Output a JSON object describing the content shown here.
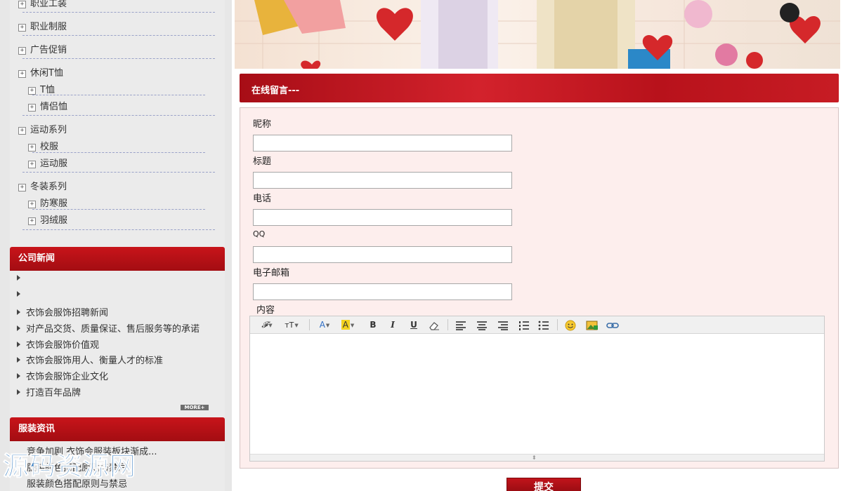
{
  "sidebar": {
    "categories": [
      {
        "label": "职业工装"
      },
      {
        "label": "职业制服"
      },
      {
        "label": "广告促销"
      },
      {
        "label": "休闲T恤"
      },
      {
        "label": "T恤"
      },
      {
        "label": "情侣恤"
      },
      {
        "label": "运动系列"
      },
      {
        "label": "校服"
      },
      {
        "label": "运动服"
      },
      {
        "label": "冬装系列"
      },
      {
        "label": "防寒服"
      },
      {
        "label": "羽绒服"
      }
    ],
    "expander": "⊞"
  },
  "company_news": {
    "title": "公司新闻",
    "items": [
      {
        "label": ""
      },
      {
        "label": ""
      },
      {
        "label": "衣饰会服饰招聘新闻"
      },
      {
        "label": "对产品交货、质量保证、售后服务等的承诺"
      },
      {
        "label": "衣饰会服饰价值观"
      },
      {
        "label": "衣饰会服饰用人、衡量人才的标准"
      },
      {
        "label": "衣饰会服饰企业文化"
      },
      {
        "label": "打造百年品牌"
      }
    ],
    "more_label": "MORE+"
  },
  "fashion_news": {
    "title": "服装资讯",
    "items": [
      {
        "label": "竞争加剧 衣饰会服装板块渐成..."
      },
      {
        "label": "服装颜色搭配原则与禁忌"
      },
      {
        "label": "服装颜色搭配原则与禁忌"
      }
    ]
  },
  "watermark": "源码资源网",
  "form": {
    "section_title": "在线留言---",
    "fields": {
      "nickname_label": "昵称",
      "title_label": "标题",
      "phone_label": "电话",
      "qq_label": "QQ",
      "email_label": "电子邮箱",
      "content_label": "内容"
    },
    "toolbar": {
      "font_family": "𝓕",
      "font_size": "тT",
      "font_color": "A",
      "bg_color": "A",
      "bold": "B",
      "italic": "I",
      "underline": "U"
    },
    "submit_label": "提交"
  },
  "colors": {
    "accent_red": "#c8141a",
    "panel_pink": "#fdeeed",
    "link_blue": "#1d6fbf"
  }
}
